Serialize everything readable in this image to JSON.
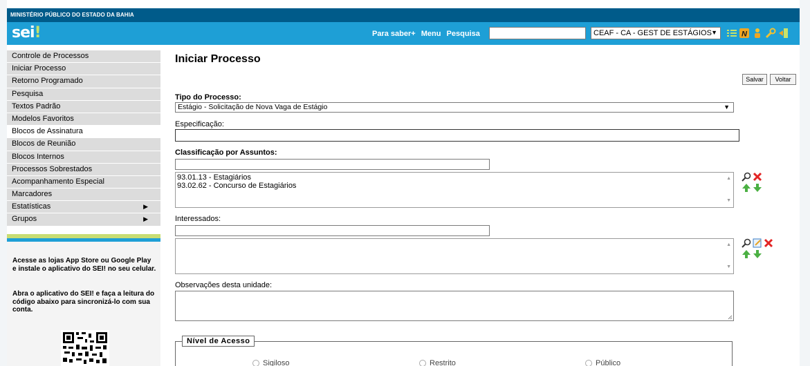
{
  "header": {
    "org_name": "MINISTÉRIO PÚBLICO DO ESTADO DA BAHIA",
    "logo": "sei",
    "logo_mark": "!",
    "nav_links": [
      "Para saber+",
      "Menu",
      "Pesquisa"
    ],
    "search_value": "",
    "unit_selected": "CEAF - CA - GEST DE ESTÁGIOS",
    "icons": [
      "list-icon",
      "notes-icon",
      "user-icon",
      "wrench-icon",
      "logout-icon"
    ]
  },
  "sidebar": {
    "items": [
      {
        "label": "Controle de Processos"
      },
      {
        "label": "Iniciar Processo"
      },
      {
        "label": "Retorno Programado"
      },
      {
        "label": "Pesquisa"
      },
      {
        "label": "Textos Padrão"
      },
      {
        "label": "Modelos Favoritos"
      },
      {
        "label": "Blocos de Assinatura"
      },
      {
        "label": "Blocos de Reunião"
      },
      {
        "label": "Blocos Internos"
      },
      {
        "label": "Processos Sobrestados"
      },
      {
        "label": "Acompanhamento Especial"
      },
      {
        "label": "Marcadores"
      },
      {
        "label": "Estatísticas"
      },
      {
        "label": "Grupos"
      }
    ],
    "promo_1": "Acesse as lojas App Store ou Google Play e instale o aplicativo do SEI! no seu celular.",
    "promo_2": "Abra o aplicativo do SEI! e faça a leitura do código abaixo para sincronizá-lo com sua conta."
  },
  "main": {
    "title": "Iniciar Processo",
    "save_label": "Salvar",
    "back_label": "Voltar",
    "tipo_label": "Tipo do Processo:",
    "tipo_value": "Estágio - Solicitação de Nova Vaga de Estágio",
    "especificacao_label": "Especificação:",
    "especificacao_value": "",
    "assuntos_label": "Classificação por Assuntos:",
    "assuntos_search": "",
    "assuntos": [
      "93.01.13 - Estagiários",
      "93.02.62 - Concurso de Estagiários"
    ],
    "interessados_label": "Interessados:",
    "interessados_search": "",
    "observacoes_label": "Observações desta unidade:",
    "observacoes_value": "",
    "nivel_acesso_label": "Nível de Acesso",
    "nivel_options": [
      "Sigiloso",
      "Restrito",
      "Público"
    ]
  }
}
